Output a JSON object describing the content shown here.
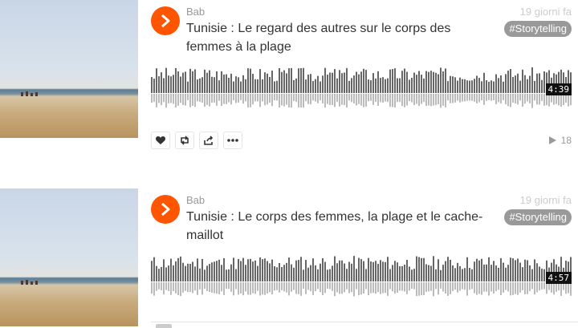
{
  "colors": {
    "brand": "#ff5500",
    "tag_bg": "#999999",
    "wave": "#666666",
    "wave_reflection": "#bbbbbb"
  },
  "tracks": [
    {
      "user": "Bab",
      "title": "Tunisie : Le regard des autres sur le corps des femmes à la plage",
      "date": "19 giorni fa",
      "tag": "#Storytelling",
      "duration": "4:39",
      "play_count": "18",
      "icons": {
        "play": "play-icon",
        "like": "heart-icon",
        "repost": "repost-icon",
        "share": "share-icon",
        "more": "more-icon"
      }
    },
    {
      "user": "Bab",
      "title": "Tunisie : Le corps des femmes, la plage et le cache-maillot",
      "date": "19 giorni fa",
      "tag": "#Storytelling",
      "duration": "4:57",
      "icons": {
        "play": "play-icon"
      }
    }
  ]
}
